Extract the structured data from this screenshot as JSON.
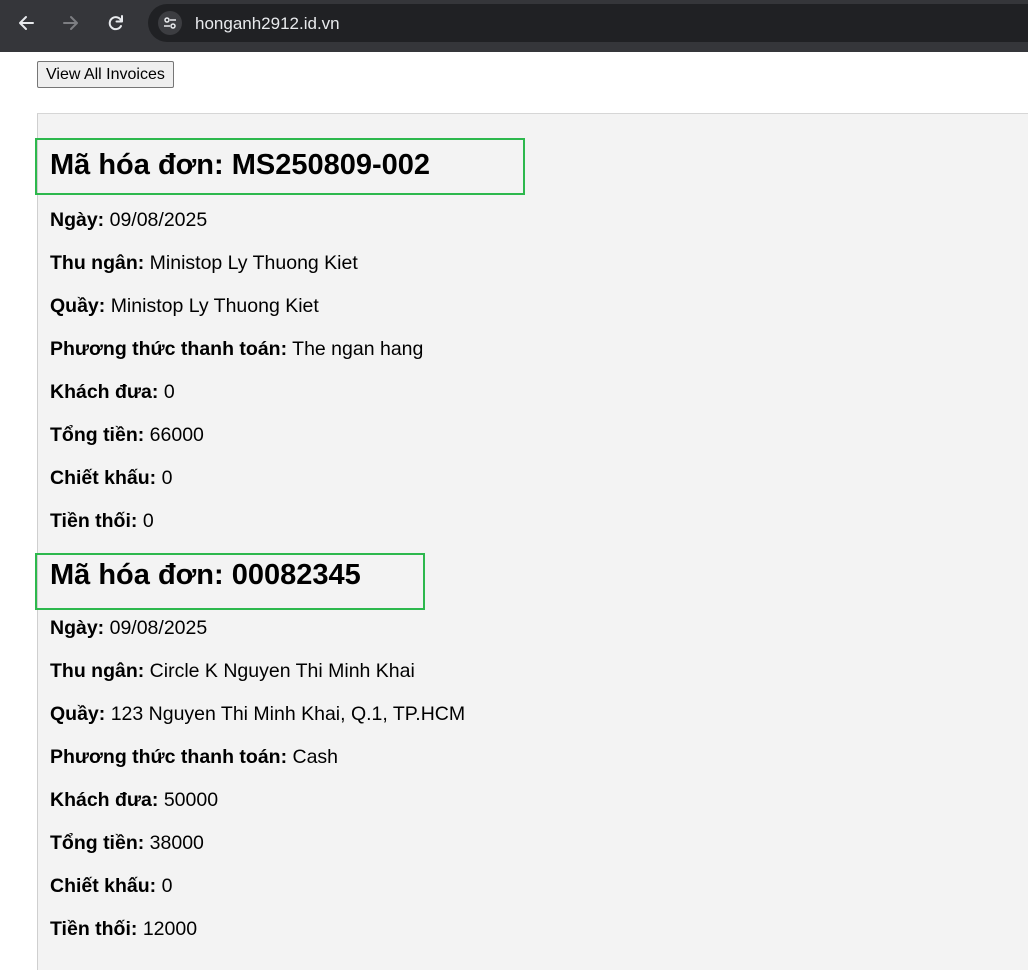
{
  "browser": {
    "url": "honganh2912.id.vn"
  },
  "toolbar": {
    "view_all_label": "View All Invoices"
  },
  "invoices": [
    {
      "title_label": "Mã hóa đơn:",
      "code": "MS250809-002",
      "fields": [
        {
          "label": "Ngày:",
          "value": "09/08/2025"
        },
        {
          "label": "Thu ngân:",
          "value": "Ministop Ly Thuong Kiet"
        },
        {
          "label": "Quầy:",
          "value": "Ministop Ly Thuong Kiet"
        },
        {
          "label": "Phương thức thanh toán:",
          "value": "The ngan hang"
        },
        {
          "label": "Khách đưa:",
          "value": "0"
        },
        {
          "label": "Tổng tiền:",
          "value": "66000"
        },
        {
          "label": "Chiết khấu:",
          "value": "0"
        },
        {
          "label": "Tiền thối:",
          "value": "0"
        }
      ]
    },
    {
      "title_label": "Mã hóa đơn:",
      "code": "00082345",
      "fields": [
        {
          "label": "Ngày:",
          "value": "09/08/2025"
        },
        {
          "label": "Thu ngân:",
          "value": "Circle K Nguyen Thi Minh Khai"
        },
        {
          "label": "Quầy:",
          "value": "123 Nguyen Thi Minh Khai, Q.1, TP.HCM"
        },
        {
          "label": "Phương thức thanh toán:",
          "value": "Cash"
        },
        {
          "label": "Khách đưa:",
          "value": "50000"
        },
        {
          "label": "Tổng tiền:",
          "value": "38000"
        },
        {
          "label": "Chiết khấu:",
          "value": "0"
        },
        {
          "label": "Tiền thối:",
          "value": "12000"
        }
      ]
    }
  ],
  "colors": {
    "highlight_border": "#2db84d",
    "panel_bg": "#f3f3f3"
  }
}
